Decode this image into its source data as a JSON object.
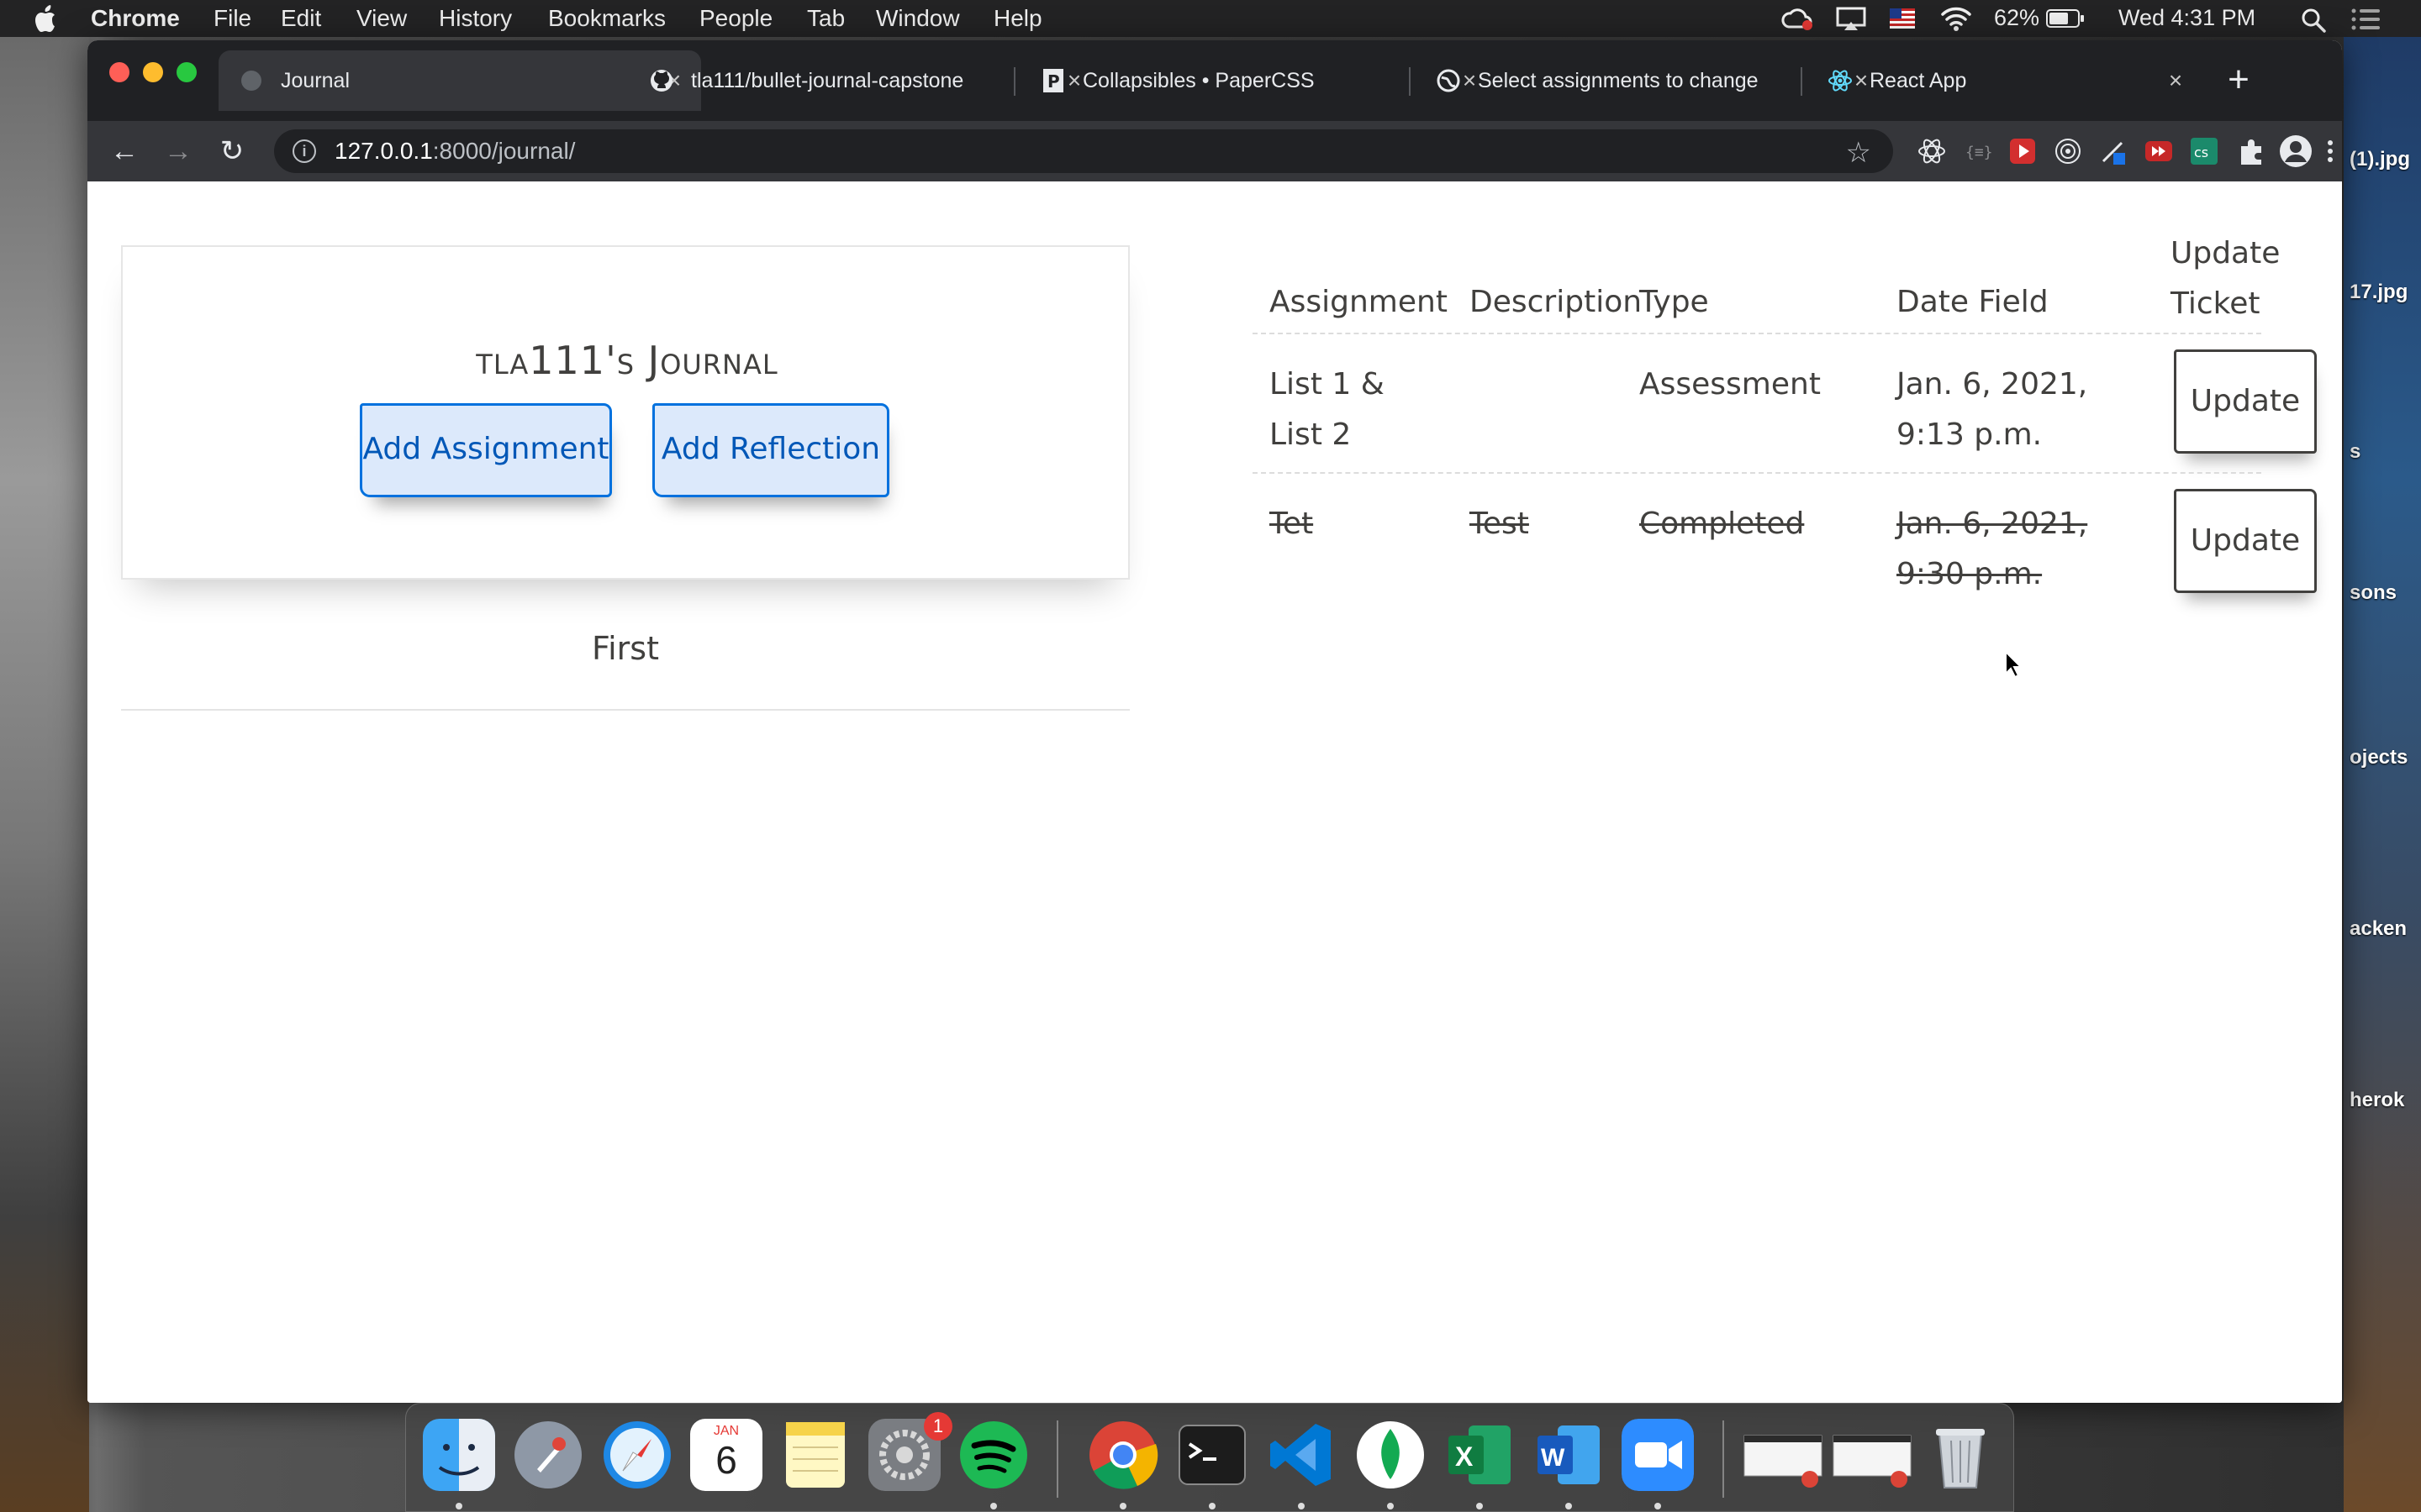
{
  "menubar": {
    "app": "Chrome",
    "items": [
      "File",
      "Edit",
      "View",
      "History",
      "Bookmarks",
      "People",
      "Tab",
      "Window",
      "Help"
    ],
    "battery": "62%",
    "clock": "Wed 4:31 PM"
  },
  "desktop": {
    "files": [
      "(1).jpg",
      "17.jpg",
      "s",
      "sons",
      "ojects",
      "acken",
      "herok"
    ]
  },
  "browser": {
    "tabs": [
      {
        "title": "Journal",
        "icon": "globe-icon",
        "active": true
      },
      {
        "title": "tla111/bullet-journal-capstone",
        "icon": "github-icon",
        "active": false
      },
      {
        "title": "Collapsibles • PaperCSS",
        "icon": "papercss-icon",
        "active": false
      },
      {
        "title": "Select assignments to change",
        "icon": "globe-icon",
        "active": false
      },
      {
        "title": "React App",
        "icon": "react-icon",
        "active": false
      }
    ],
    "url": {
      "host": "127.0.0.1",
      "rest": ":8000/journal/"
    }
  },
  "page": {
    "journal_title": "tla111's Journal",
    "add_assignment": "Add Assignment",
    "add_reflection": "Add Reflection",
    "first_label": "First",
    "table": {
      "headers": [
        "Assignment",
        "Description",
        "Type",
        "Date Field",
        "Update Ticket"
      ],
      "rows": [
        {
          "assignment": "List 1 & List 2",
          "description": "",
          "type": "Assessment",
          "date": "Jan. 6, 2021, 9:13 p.m.",
          "update": "Update",
          "completed": false
        },
        {
          "assignment": "Tet",
          "description": "Test",
          "type": "Completed",
          "date": "Jan. 6, 2021, 9:30 p.m.",
          "update": "Update",
          "completed": true
        }
      ]
    }
  },
  "dock": {
    "calendar_month": "JAN",
    "calendar_day": "6",
    "badge_count": "1"
  },
  "colors": {
    "paper_blue_bg": "#dce9fb",
    "paper_blue_border": "#0071de",
    "text": "#41403e"
  }
}
